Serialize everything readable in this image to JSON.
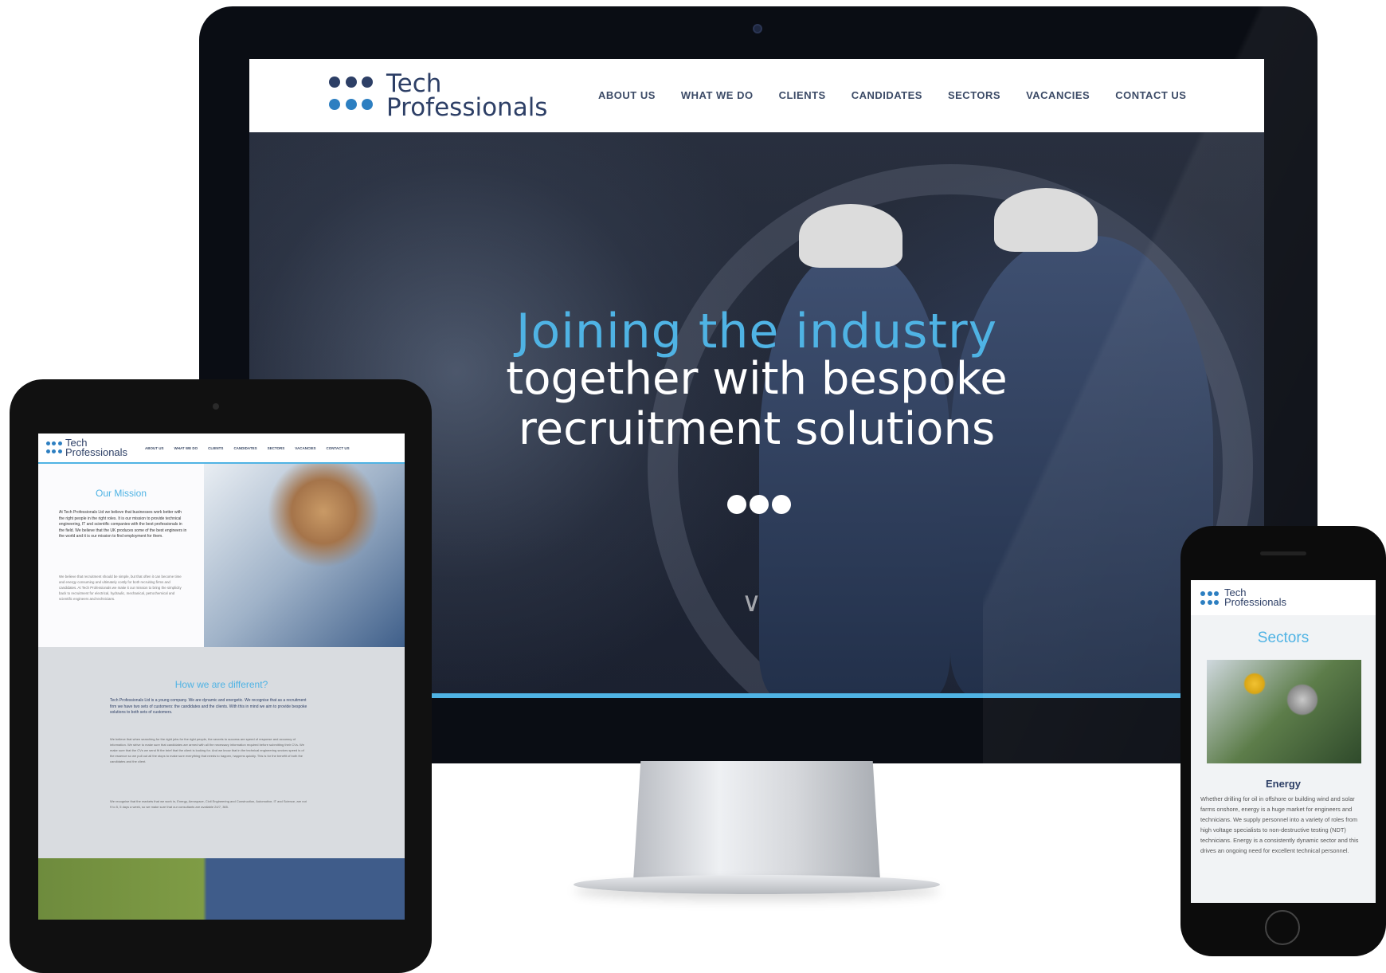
{
  "desktop": {
    "brand": {
      "line1": "Tech",
      "line2": "Professionals"
    },
    "nav": [
      "ABOUT US",
      "WHAT WE DO",
      "CLIENTS",
      "CANDIDATES",
      "SECTORS",
      "VACANCIES",
      "CONTACT US"
    ],
    "hero": {
      "line1": "Joining the industry",
      "line2": "together with bespoke",
      "line3": "recruitment solutions"
    },
    "colors": {
      "accent": "#4fb3e4",
      "brand_navy": "#2d3f66"
    }
  },
  "tablet": {
    "brand": {
      "line1": "Tech",
      "line2": "Professionals"
    },
    "nav": [
      "ABOUT US",
      "WHAT WE DO",
      "CLIENTS",
      "CANDIDATES",
      "SECTORS",
      "VACANCIES",
      "CONTACT US"
    ],
    "mission": {
      "title": "Our Mission",
      "para1": "At Tech Professionals Ltd we believe that businesses work better with the right people in the right roles. It is our mission to provide technical engineering, IT and scientific companies with the best professionals in the field. We believe that the UK produces some of the best engineers in the world and it is our mission to find employment for them.",
      "para2": "We believe that recruitment should be simple, but that often it can become time and energy consuming and ultimately costly for both recruiting firms and candidates. At Tech Professionals we make it our mission to bring the simplicity back to recruitment for electrical, hydraulic, mechanical, petrochemical and scientific engineers and technicians."
    },
    "different": {
      "title": "How we are different?",
      "para1": "Tech Professionals Ltd is a young company. We are dynamic and energetic. We recognise that as a recruitment firm we have two sets of customers: the candidates and the clients. With this in mind we aim to provide bespoke solutions to both sets of customers.",
      "para2": "We believe that when searching for the right jobs for the right people, the secrets to success are speed of response and accuracy of information. We strive to make sure that candidates are armed with all the necessary information required before submitting their CVs. We make sure that the CVs we send fit the brief that the client is looking for. And we know that in the technical engineering sectors speed is of the essence so we pull out all the stops to make sure everything that needs to happen, happens quickly. This is for the benefit of both the candidates and the client.",
      "para3": "We recognise that the markets that we work in, Energy, Aerospace, Civil Engineering and Construction, Automotive, IT and Science, are not 9 to 5, 5 days a week, so we make sure that our consultants are available 24/7, 365."
    }
  },
  "phone": {
    "brand": {
      "line1": "Tech",
      "line2": "Professionals"
    },
    "section_title": "Sectors",
    "sector_name": "Energy",
    "sector_text": "Whether drilling for oil in offshore or building wind and solar farms onshore, energy is a huge market for engineers and technicians. We supply personnel into a variety of roles from high voltage specialists to non-destructive testing (NDT) technicians. Energy is a consistently dynamic sector and this drives an ongoing need for excellent technical personnel."
  }
}
